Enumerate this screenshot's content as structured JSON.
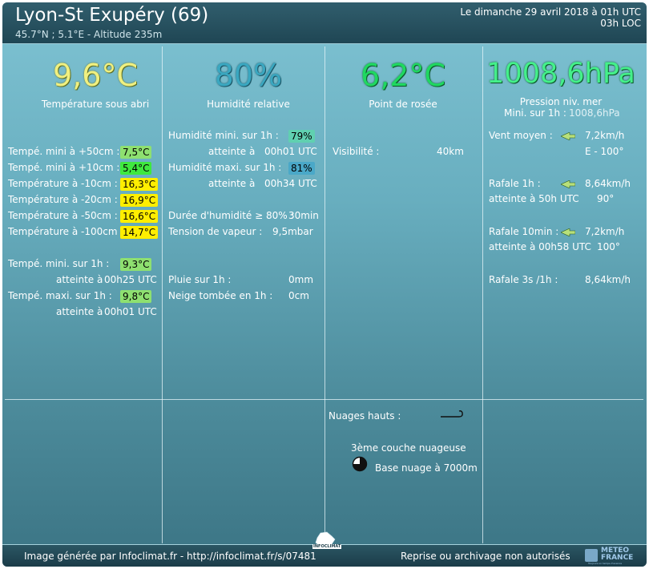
{
  "header": {
    "title": "Lyon-St Exupéry (69)",
    "subtitle": "45.7°N ; 5.1°E - Altitude 235m",
    "date": "Le dimanche 29 avril 2018 à 01h UTC",
    "local_time": "03h LOC"
  },
  "colors": {
    "temp_big": "#f0f080",
    "humidity_big": "#3aa7c0",
    "dewpoint_big": "#1fd860",
    "pressure_big": "#44f08a",
    "badge_green": "#8ee070",
    "badge_bright_green": "#3fe83f",
    "badge_yellow": "#ffee00",
    "badge_teal": "#60d0b0",
    "badge_blue": "#4aa8c8"
  },
  "main": {
    "temperature": {
      "value": "9,6°C",
      "label": "Température sous abri"
    },
    "humidity": {
      "value": "80%",
      "label": "Humidité relative"
    },
    "dewpoint": {
      "value": "6,2°C",
      "label": "Point de rosée"
    },
    "pressure": {
      "value": "1008,6hPa",
      "label": "Pression niv. mer",
      "min_label": "Mini. sur 1h :",
      "min_value": "1008,6hPa"
    }
  },
  "col1": {
    "rows": [
      {
        "label": "Tempé. mini à +50cm :",
        "value": "7,5°C"
      },
      {
        "label": "Tempé. mini à +10cm :",
        "value": "5,4°C"
      },
      {
        "label": "Température à -10cm :",
        "value": "16,3°C"
      },
      {
        "label": "Température à -20cm :",
        "value": "16,9°C"
      },
      {
        "label": "Température à -50cm :",
        "value": "16,6°C"
      },
      {
        "label": "Température à -100cm :",
        "value": "14,7°C"
      }
    ],
    "min_label": "Tempé. mini. sur 1h :",
    "min_value": "9,3°C",
    "min_at_label": "atteinte à",
    "min_at_value": "00h25 UTC",
    "max_label": "Tempé. maxi. sur 1h :",
    "max_value": "9,8°C",
    "max_at_label": "atteinte à",
    "max_at_value": "00h01 UTC"
  },
  "col2": {
    "hum_min_label": "Humidité mini. sur 1h :",
    "hum_min_value": "79%",
    "hum_min_at_label": "atteinte à",
    "hum_min_at_value": "00h01 UTC",
    "hum_max_label": "Humidité maxi. sur 1h :",
    "hum_max_value": "81%",
    "hum_max_at_label": "atteinte à",
    "hum_max_at_value": "00h34 UTC",
    "duration_label": "Durée d'humidité ≥ 80% :",
    "duration_value": "30min",
    "vapor_label": "Tension de vapeur :",
    "vapor_value": "9,5mbar",
    "rain_label": "Pluie sur 1h :",
    "rain_value": "0mm",
    "snow_label": "Neige tombée en 1h :",
    "snow_value": "0cm"
  },
  "col3": {
    "visibility_label": "Visibilité :",
    "visibility_value": "40km",
    "clouds_label": "Nuages hauts :",
    "layer_label": "3ème couche nuageuse",
    "base_label": "Base nuage à 7000m"
  },
  "col4": {
    "wind_label": "Vent moyen :",
    "wind_value": "7,2km/h",
    "wind_dir": "E - 100°",
    "gust1h_label": "Rafale 1h :",
    "gust1h_value": "8,64km/h",
    "gust1h_at": "atteinte à 50h UTC",
    "gust1h_dir": "90°",
    "gust10_label": "Rafale 10min :",
    "gust10_value": "7,2km/h",
    "gust10_at": "atteinte à 00h58 UTC",
    "gust10_dir": "100°",
    "gust3s_label": "Rafale 3s /1h :",
    "gust3s_value": "8,64km/h"
  },
  "footer": {
    "left": "Image générée par Infoclimat.fr - http://infoclimat.fr/s/07481",
    "right": "Reprise ou archivage non autorisés",
    "logo_left": "INFOCLIMAT",
    "logo_right_1": "METEO",
    "logo_right_2": "FRANCE",
    "logo_right_3": "Toujours un temps d'avance"
  }
}
